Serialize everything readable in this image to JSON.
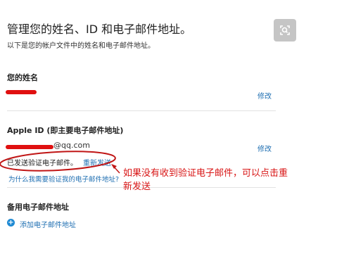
{
  "header": {
    "title": "管理您的姓名、ID 和电子邮件地址。",
    "subtitle": "以下是您的帐户文件中的姓名和电子邮件地址。"
  },
  "name_section": {
    "heading": "您的姓名",
    "edit_label": "修改"
  },
  "appleid_section": {
    "heading": "Apple ID (即主要电子邮件地址)",
    "email_suffix": "@qq.com",
    "edit_label": "修改",
    "verify_sent": "已发送验证电子邮件。",
    "resend_label": "重新发送",
    "why_link": "为什么我需要验证我的电子邮件地址?"
  },
  "backup_section": {
    "heading": "备用电子邮件地址",
    "add_label": "添加电子邮件地址"
  },
  "annotation": {
    "line1": "如果没有收到验证电子邮件，可以点击重",
    "line2": "新发送"
  },
  "colors": {
    "link": "#1f6fb2",
    "annotation_red": "#d81515",
    "search_button_bg": "#c5c5c5"
  },
  "icons": {
    "search": "search-icon",
    "add": "plus-circle-icon"
  }
}
